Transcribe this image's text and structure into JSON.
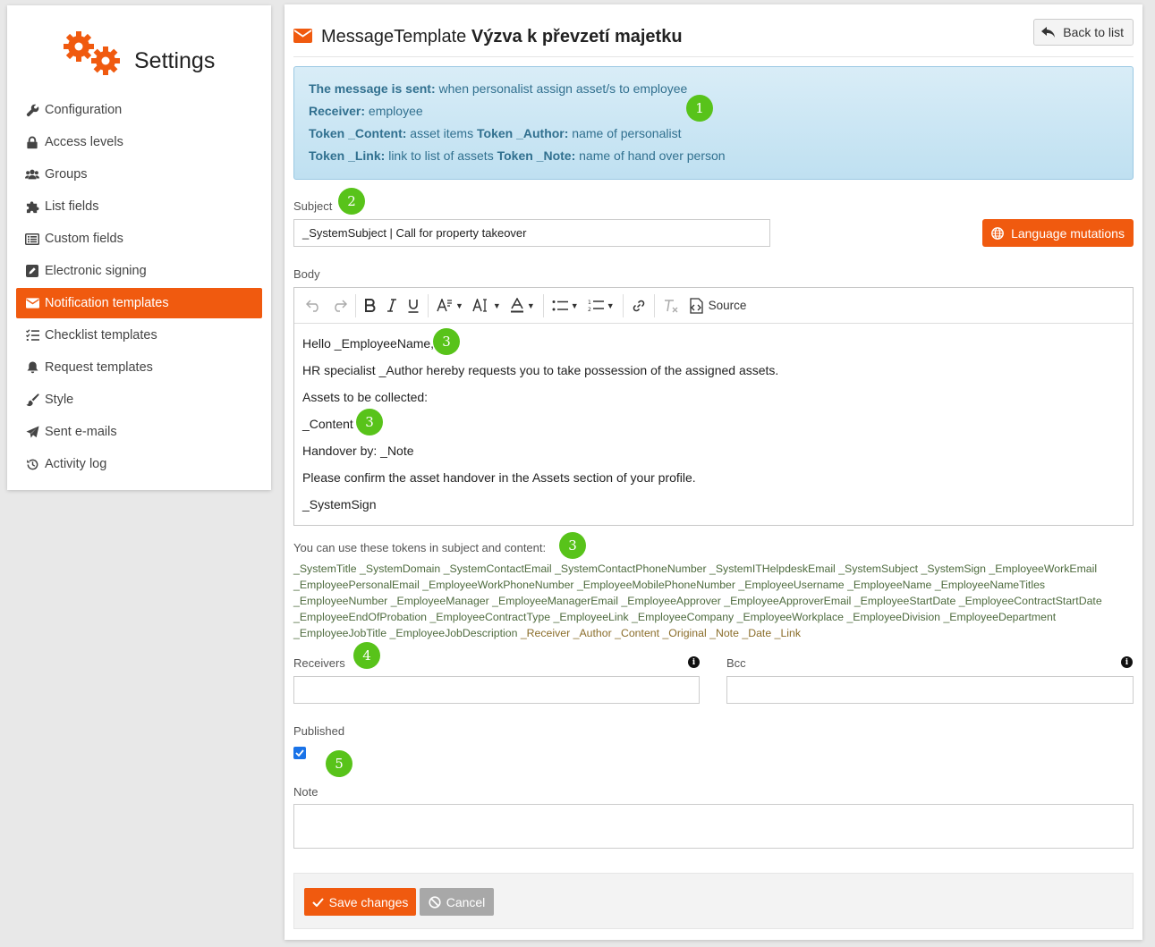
{
  "brand": {
    "title": "Settings",
    "icon": "gears-icon",
    "color": "#f05a0f"
  },
  "sidebar": {
    "items": [
      {
        "label": "Configuration",
        "icon": "wrench-icon"
      },
      {
        "label": "Access levels",
        "icon": "lock-icon"
      },
      {
        "label": "Groups",
        "icon": "users-icon"
      },
      {
        "label": "List fields",
        "icon": "puzzle-icon"
      },
      {
        "label": "Custom fields",
        "icon": "list-icon"
      },
      {
        "label": "Electronic signing",
        "icon": "sign-icon"
      },
      {
        "label": "Notification templates",
        "icon": "envelope-icon",
        "active": true
      },
      {
        "label": "Checklist templates",
        "icon": "checklist-icon"
      },
      {
        "label": "Request templates",
        "icon": "bell-icon"
      },
      {
        "label": "Style",
        "icon": "brush-icon"
      },
      {
        "label": "Sent e-mails",
        "icon": "paper-plane-icon"
      },
      {
        "label": "Activity log",
        "icon": "history-icon"
      }
    ]
  },
  "header": {
    "prefix": "MessageTemplate",
    "name": "Výzva k převzetí majetku",
    "back_label": "Back to list"
  },
  "info": {
    "l1_key": "The message is sent:",
    "l1_val": " when personalist assign asset/s to employee",
    "l2_key": "Receiver:",
    "l2_val": " employee",
    "l3_key1": "Token _Content:",
    "l3_val1": " asset items ",
    "l3_key2": "Token _Author:",
    "l3_val2": " name of personalist",
    "l4_key1": "Token _Link:",
    "l4_val1": " link to list of assets ",
    "l4_key2": "Token _Note:",
    "l4_val2": " name of hand over person"
  },
  "badges": {
    "b1": "1",
    "b2": "2",
    "b3": "3",
    "b4": "4",
    "b5": "5"
  },
  "subject": {
    "label": "Subject",
    "value": "_SystemSubject | Call for property takeover"
  },
  "language_button": "Language mutations",
  "body": {
    "label": "Body",
    "source_label": "Source",
    "lines": [
      "Hello _EmployeeName,",
      "HR specialist _Author hereby requests you to take possession of the assigned assets.",
      "Assets to be collected:",
      "_Content",
      "Handover by: _Note",
      "Please confirm the asset handover in the Assets section of your profile.",
      "_SystemSign"
    ]
  },
  "tokens": {
    "label": "You can use these tokens in subject and content:",
    "system": [
      "_SystemTitle",
      "_SystemDomain",
      "_SystemContactEmail",
      "_SystemContactPhoneNumber",
      "_SystemITHelpdeskEmail",
      "_SystemSubject",
      "_SystemSign",
      "_EmployeeWorkEmail",
      "_EmployeePersonalEmail",
      "_EmployeeWorkPhoneNumber",
      "_EmployeeMobilePhoneNumber",
      "_EmployeeUsername",
      "_EmployeeName",
      "_EmployeeNameTitles",
      "_EmployeeNumber",
      "_EmployeeManager",
      "_EmployeeManagerEmail",
      "_EmployeeApprover",
      "_EmployeeApproverEmail",
      "_EmployeeStartDate",
      "_EmployeeContractStartDate",
      "_EmployeeEndOfProbation",
      "_EmployeeContractType",
      "_EmployeeLink",
      "_EmployeeCompany",
      "_EmployeeWorkplace",
      "_EmployeeDivision",
      "_EmployeeDepartment",
      "_EmployeeJobTitle",
      "_EmployeeJobDescription"
    ],
    "message": [
      "_Receiver",
      "_Author",
      "_Content",
      "_Original",
      "_Note",
      "_Date",
      "_Link"
    ]
  },
  "receivers": {
    "label": "Receivers",
    "value": ""
  },
  "bcc": {
    "label": "Bcc",
    "value": ""
  },
  "published": {
    "label": "Published",
    "checked": true
  },
  "note": {
    "label": "Note",
    "value": ""
  },
  "footer": {
    "save_label": "Save changes",
    "cancel_label": "Cancel"
  }
}
